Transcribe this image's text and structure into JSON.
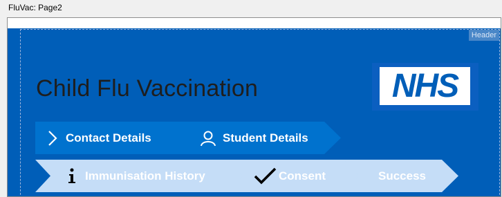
{
  "window": {
    "title": "FluVac: Page2"
  },
  "designer": {
    "header_tag": "Header"
  },
  "page": {
    "title": "Child Flu Vaccination"
  },
  "logo": {
    "text": "NHS"
  },
  "steps": [
    {
      "label": "Contact Details",
      "icon": "chevron-right-icon",
      "state": "active"
    },
    {
      "label": "Student Details",
      "icon": "person-icon",
      "state": "active"
    },
    {
      "label": "Immunisation History",
      "icon": "info-icon",
      "state": "inactive"
    },
    {
      "label": "Consent",
      "icon": "checkmark-icon",
      "state": "inactive"
    },
    {
      "label": "Success",
      "icon": "",
      "state": "inactive"
    }
  ],
  "colors": {
    "nhs_blue": "#005eb8",
    "active_step": "#0072ce",
    "inactive_step": "#c5ddf7"
  }
}
